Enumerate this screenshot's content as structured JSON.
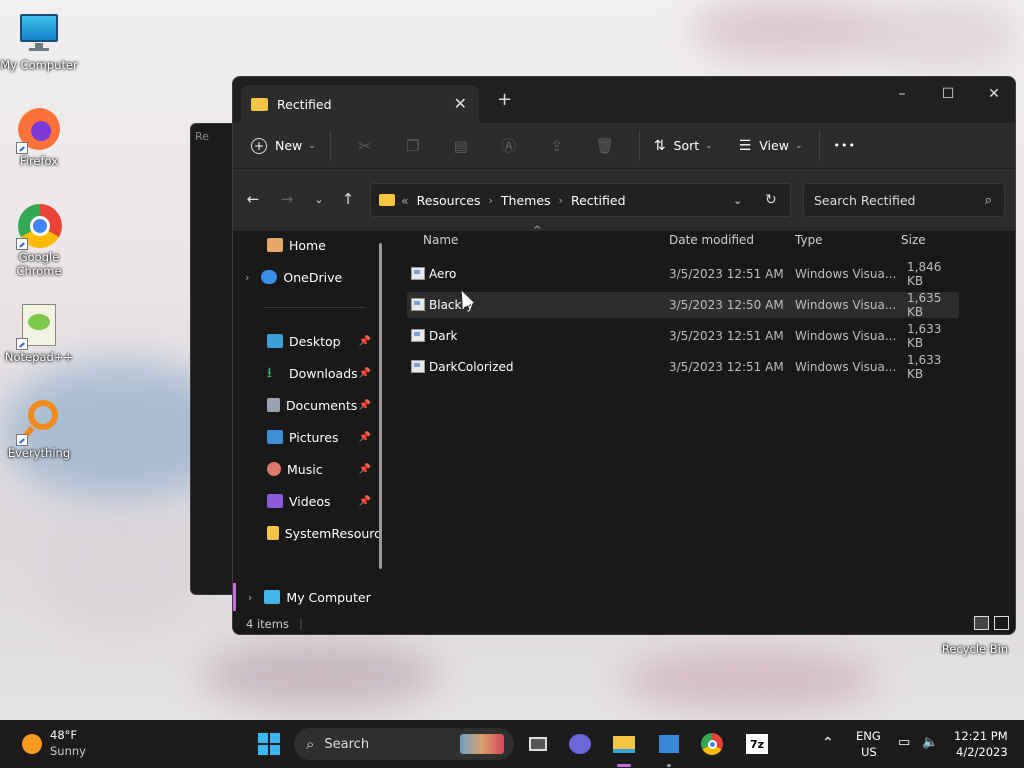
{
  "desktop": {
    "icons": [
      {
        "label": "My Computer",
        "icon": "monitor-icon"
      },
      {
        "label": "Firefox",
        "icon": "firefox-icon"
      },
      {
        "label": "Google Chrome",
        "icon": "chrome-icon"
      },
      {
        "label": "Notepad++",
        "icon": "notepadpp-icon"
      },
      {
        "label": "Everything",
        "icon": "magnifier-icon"
      },
      {
        "label": "Recycle Bin",
        "icon": "recycle-bin-icon"
      }
    ],
    "back_window_title": "Re"
  },
  "explorer": {
    "tab_title": "Rectified",
    "new_tab": "+",
    "window_controls": {
      "minimize": "–",
      "maximize": "☐",
      "close": "✕"
    },
    "toolbar": {
      "new_label": "New",
      "sort_label": "Sort",
      "view_label": "View",
      "more_label": "•••"
    },
    "address": {
      "overflow": "«",
      "crumbs": [
        "Resources",
        "Themes",
        "Rectified"
      ],
      "search_placeholder": "Search Rectified"
    },
    "nav": {
      "home": "Home",
      "onedrive": "OneDrive",
      "desktop": "Desktop",
      "downloads": "Downloads",
      "documents": "Documents",
      "pictures": "Pictures",
      "music": "Music",
      "videos": "Videos",
      "systemresources": "SystemResourc",
      "mycomputer": "My Computer"
    },
    "columns": {
      "name": "Name",
      "date": "Date modified",
      "type": "Type",
      "size": "Size"
    },
    "files": [
      {
        "name": "Aero",
        "date": "3/5/2023 12:51 AM",
        "type": "Windows Visua...",
        "size": "1,846 KB"
      },
      {
        "name": "Blackry",
        "date": "3/5/2023 12:50 AM",
        "type": "Windows Visua...",
        "size": "1,635 KB"
      },
      {
        "name": "Dark",
        "date": "3/5/2023 12:51 AM",
        "type": "Windows Visua...",
        "size": "1,633 KB"
      },
      {
        "name": "DarkColorized",
        "date": "3/5/2023 12:51 AM",
        "type": "Windows Visua...",
        "size": "1,633 KB"
      }
    ],
    "status": "4 items"
  },
  "taskbar": {
    "weather_temp": "48°F",
    "weather_desc": "Sunny",
    "search_label": "Search",
    "lang_top": "ENG",
    "lang_bottom": "US",
    "time": "12:21 PM",
    "date": "4/2/2023",
    "sevenzip_label": "7z"
  },
  "colors": {
    "accent": "#0078d4",
    "folder": "#f4c542"
  }
}
